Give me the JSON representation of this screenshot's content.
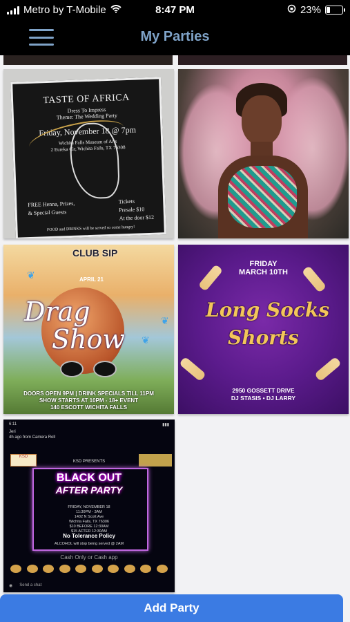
{
  "status_bar": {
    "carrier": "Metro by T-Mobile",
    "time": "8:47 PM",
    "battery": "23%",
    "icons": [
      "signal-icon",
      "wifi-icon",
      "lock-rotation-icon",
      "battery-icon"
    ]
  },
  "nav": {
    "title": "My Parties",
    "menu_icon": "hamburger-menu-icon"
  },
  "parties": [
    {
      "title": "TASTE OF AFRICA",
      "line2": "Dress To Impress",
      "line3": "Theme: The Wedding Party",
      "date": "Friday, November 18 @ 7pm",
      "venue": "Wichita Falls Museum of Arts",
      "address": "2 Eureka Cir, Wichita Falls, TX 76308",
      "left_text": "FREE Henna, Prizes, & Special Guests",
      "tickets": "Tickets",
      "presale": "Presale $10",
      "door": "At the door $12",
      "footer": "FOOD and DRINKS will be served so come hungry!"
    },
    {
      "title": ""
    },
    {
      "club": "CLUB SIP",
      "month": "APRIL 21",
      "word1": "Drag",
      "word2": "Show",
      "info1": "DOORS OPEN 9PM | DRINK SPECIALS TILL 11PM",
      "info2": "SHOW STARTS AT 10PM - 18+ EVENT",
      "info3": "140 ESCOTT WICHITA FALLS"
    },
    {
      "day": "FRIDAY",
      "date": "MARCH 10TH",
      "word1": "Long Socks",
      "word2": "Shorts",
      "address": "2950 GOSSETT DRIVE",
      "djs": "DJ STASIS • DJ LARRY"
    },
    {
      "phone_time": "6:11",
      "user": "Jeri",
      "user_sub": "4h ago from Camera Roll",
      "presents": "KSD PRESENTS",
      "title1": "BLACK OUT",
      "title2": "AFTER PARTY",
      "details1": "FRIDAY, NOVEMBER 18",
      "details2": "11:30PM - 3AM",
      "details3": "1402 N Scott Ave",
      "details4": "Wichita Falls, TX 76306",
      "details5": "$10 BEFORE 12:30AM",
      "details6": "$15 AFTER 12:30AM",
      "policy": "No Tolerance Policy",
      "alcohol": "ALCOHOL will stop being served @ 2AM",
      "cash": "Cash Only or Cash app",
      "reply": "Send a chat"
    }
  ],
  "add_button": "Add Party"
}
